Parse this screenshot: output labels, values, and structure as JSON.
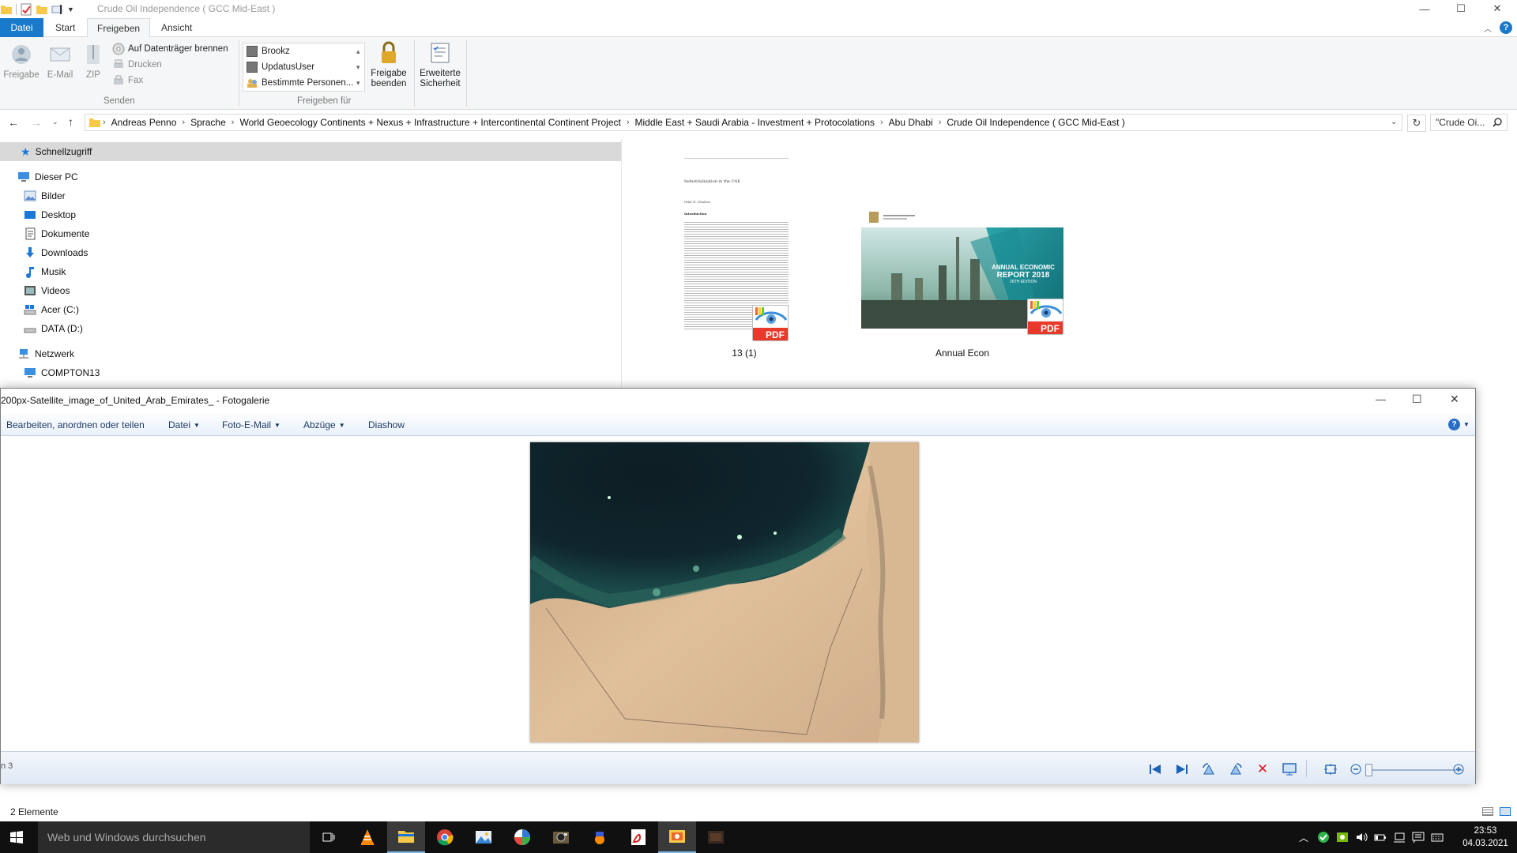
{
  "explorer": {
    "title": "Crude Oil Independence  ( GCC Mid-East )",
    "window_buttons": {
      "minimize": "—",
      "maximize": "☐",
      "close": "✕"
    },
    "tabs": {
      "file": "Datei",
      "start": "Start",
      "share": "Freigeben",
      "view": "Ansicht"
    },
    "ribbon": {
      "send": {
        "share": "Freigabe",
        "email": "E-Mail",
        "zip": "ZIP",
        "burn": "Auf Datenträger brennen",
        "print": "Drucken",
        "fax": "Fax",
        "group": "Senden"
      },
      "share_with": {
        "items": [
          "Brookz",
          "UpdatusUser",
          "Bestimmte Personen..."
        ],
        "group": "Freigeben für"
      },
      "stop_sharing": [
        "Freigabe",
        "beenden"
      ],
      "advanced_security": [
        "Erweiterte",
        "Sicherheit"
      ]
    },
    "breadcrumb": [
      "Andreas Penno",
      "Sprache",
      "World Geoecology Continents + Nexus + Infrastructure + Intercontinental Continent Project",
      "Middle East + Saudi Arabia - Investment + Protocolations",
      "Abu Dhabi",
      "Crude Oil Independence  ( GCC Mid-East )"
    ],
    "search_placeholder": "\"Crude Oi...",
    "nav": {
      "quick_access": "Schnellzugriff",
      "this_pc": "Dieser PC",
      "pc_items": [
        "Bilder",
        "Desktop",
        "Dokumente",
        "Downloads",
        "Musik",
        "Videos",
        "Acer (C:)",
        "DATA (D:)"
      ],
      "network": "Netzwerk",
      "network_items": [
        "COMPTON13"
      ]
    },
    "files": [
      {
        "name": "13 (1)",
        "badge": "PDF",
        "doc_title": "Industrialization in the UAE",
        "doc_author": "Hilal H. Dhaheri",
        "doc_heading": "Introduction"
      },
      {
        "name": "Annual Econ",
        "badge": "PDF",
        "cover_lines": [
          "ANNUAL ECONOMIC",
          "REPORT 2018",
          "26TH EDITION"
        ]
      }
    ],
    "status": "2 Elemente"
  },
  "gallery": {
    "title": "200px-Satellite_image_of_United_Arab_Emirates_ - Fotogalerie",
    "toolbar": {
      "organize": "Bearbeiten, anordnen oder teilen",
      "file": "Datei",
      "email": "Foto-E-Mail",
      "prints": "Abzüge",
      "slideshow": "Diashow",
      "help": "?"
    },
    "footer_counter": "n 3"
  },
  "taskbar": {
    "search_placeholder": "Web und Windows durchsuchen",
    "time": "23:53",
    "date": "04.03.2021"
  },
  "colors": {
    "file_tab": "#1979ca",
    "gallery_toolbar_text": "#1e3a66",
    "gallery_icons": "#1a63b8",
    "delete_icon": "#d02020",
    "taskbar": "#101010"
  }
}
